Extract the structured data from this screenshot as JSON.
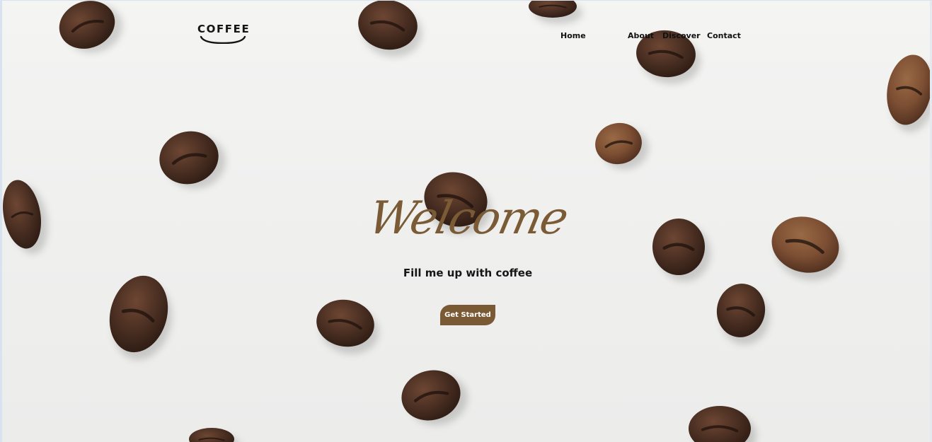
{
  "header": {
    "logo_text": "COFFEE"
  },
  "nav": {
    "items": [
      {
        "id": "home",
        "label": "Home"
      },
      {
        "id": "about",
        "label": "About"
      },
      {
        "id": "discover",
        "label": "Discover"
      },
      {
        "id": "contact",
        "label": "Contact"
      }
    ]
  },
  "hero": {
    "title": "Welcome",
    "subtitle": "Fill me up with coffee",
    "cta_label": "Get Started",
    "background_image": "coffee-beans-on-white-surface"
  },
  "colors": {
    "accent": "#7a5a34",
    "title": "#7a5b36",
    "bean_dark": "#4a2f22",
    "bean_light": "#7d4f33",
    "text": "#111111"
  }
}
